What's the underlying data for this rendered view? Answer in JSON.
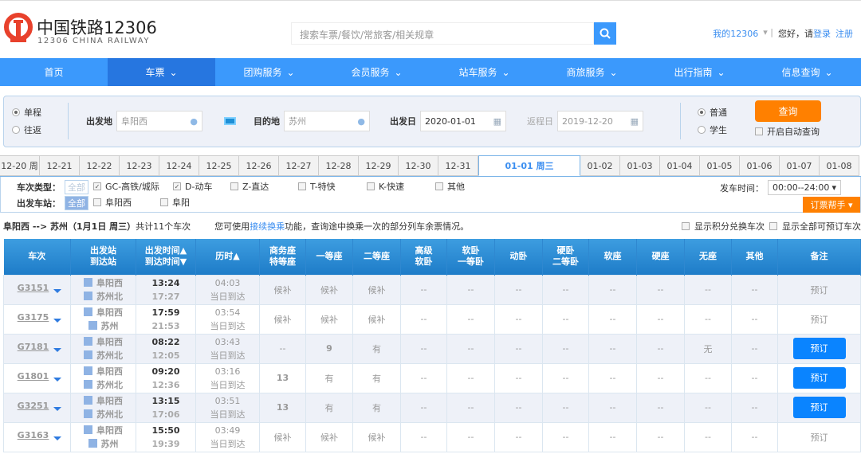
{
  "header": {
    "logo_cn": "中国铁路12306",
    "logo_en": "12306 CHINA RAILWAY",
    "search_placeholder": "搜索车票/餐饮/常旅客/相关规章",
    "my12306": "我的12306",
    "greeting": "您好，请",
    "login": "登录",
    "register": "注册"
  },
  "nav": [
    "首页",
    "车票",
    "团购服务",
    "会员服务",
    "站车服务",
    "商旅服务",
    "出行指南",
    "信息查询"
  ],
  "query": {
    "oneway": "单程",
    "roundtrip": "往返",
    "from_label": "出发地",
    "from": "阜阳西",
    "to_label": "目的地",
    "to": "苏州",
    "date_label": "出发日",
    "date": "2020-01-01",
    "return_label": "返程日",
    "return_date": "2019-12-20",
    "normal": "普通",
    "student": "学生",
    "search": "查询",
    "auto": "开启自动查询"
  },
  "dates": [
    "12-20 周",
    "12-21",
    "12-22",
    "12-23",
    "12-24",
    "12-25",
    "12-26",
    "12-27",
    "12-28",
    "12-29",
    "12-30",
    "12-31",
    "01-01 周三",
    "01-02",
    "01-03",
    "01-04",
    "01-05",
    "01-06",
    "01-07",
    "01-08"
  ],
  "filters": {
    "type_label": "车次类型：",
    "all": "全部",
    "types": [
      "GC-高铁/城际",
      "D-动车",
      "Z-直达",
      "T-特快",
      "K-快速",
      "其他"
    ],
    "station_label": "出发车站：",
    "stations": [
      "阜阳西",
      "阜阳"
    ],
    "time_label": "发车时间：",
    "time": "00:00--24:00",
    "helper": "订票帮手"
  },
  "summary": {
    "route": "阜阳西 --> 苏州（1月1日  周三）",
    "count": "共计11个车次",
    "tip_pre": "您可使用",
    "tip_link": "接续换乘",
    "tip_post": "功能，查询途中换乘一次的部分列车余票情况。",
    "opt1": "显示积分兑换车次",
    "opt2": "显示全部可预订车次"
  },
  "columns": [
    "车次",
    "出发站\n到达站",
    "出发时间▲\n到达时间▼",
    "历时▲",
    "商务座\n特等座",
    "一等座",
    "二等座",
    "高级\n软卧",
    "软卧\n一等卧",
    "动卧",
    "硬卧\n二等卧",
    "软座",
    "硬座",
    "无座",
    "其他",
    "备注"
  ],
  "rows": [
    {
      "train": "G3151",
      "from": "阜阳西",
      "to": "苏州北",
      "dep": "13:24",
      "arr": "17:27",
      "dur": "04:03",
      "arrive": "当日到达",
      "seats": [
        "候补",
        "候补",
        "候补",
        "--",
        "--",
        "--",
        "--",
        "--",
        "--",
        "--",
        "--"
      ],
      "book": "预订",
      "bookable": false
    },
    {
      "train": "G3175",
      "from": "阜阳西",
      "to": "苏州",
      "dep": "17:59",
      "arr": "21:53",
      "dur": "03:54",
      "arrive": "当日到达",
      "seats": [
        "候补",
        "候补",
        "候补",
        "--",
        "--",
        "--",
        "--",
        "--",
        "--",
        "--",
        "--"
      ],
      "book": "预订",
      "bookable": false
    },
    {
      "train": "G7181",
      "from": "阜阳西",
      "to": "苏州北",
      "dep": "08:22",
      "arr": "12:05",
      "dur": "03:43",
      "arrive": "当日到达",
      "seats": [
        "--",
        "9",
        "有",
        "--",
        "--",
        "--",
        "--",
        "--",
        "--",
        "无",
        "--"
      ],
      "book": "预订",
      "bookable": true
    },
    {
      "train": "G1801",
      "from": "阜阳西",
      "to": "苏州北",
      "dep": "09:20",
      "arr": "12:36",
      "dur": "03:16",
      "arrive": "当日到达",
      "seats": [
        "13",
        "有",
        "有",
        "--",
        "--",
        "--",
        "--",
        "--",
        "--",
        "--",
        "--"
      ],
      "book": "预订",
      "bookable": true
    },
    {
      "train": "G3251",
      "from": "阜阳西",
      "to": "苏州北",
      "dep": "13:15",
      "arr": "17:06",
      "dur": "03:51",
      "arrive": "当日到达",
      "seats": [
        "13",
        "有",
        "有",
        "--",
        "--",
        "--",
        "--",
        "--",
        "--",
        "--",
        "--"
      ],
      "book": "预订",
      "bookable": true
    },
    {
      "train": "G3163",
      "from": "阜阳西",
      "to": "苏州",
      "dep": "15:50",
      "arr": "19:39",
      "dur": "03:49",
      "arrive": "当日到达",
      "seats": [
        "候补",
        "候补",
        "候补",
        "--",
        "--",
        "--",
        "--",
        "--",
        "--",
        "--",
        "--"
      ],
      "book": "预订",
      "bookable": false
    }
  ],
  "colors": {
    "nav": "#3b99fc",
    "accent": "#ff8000",
    "book": "#0a84ff"
  }
}
